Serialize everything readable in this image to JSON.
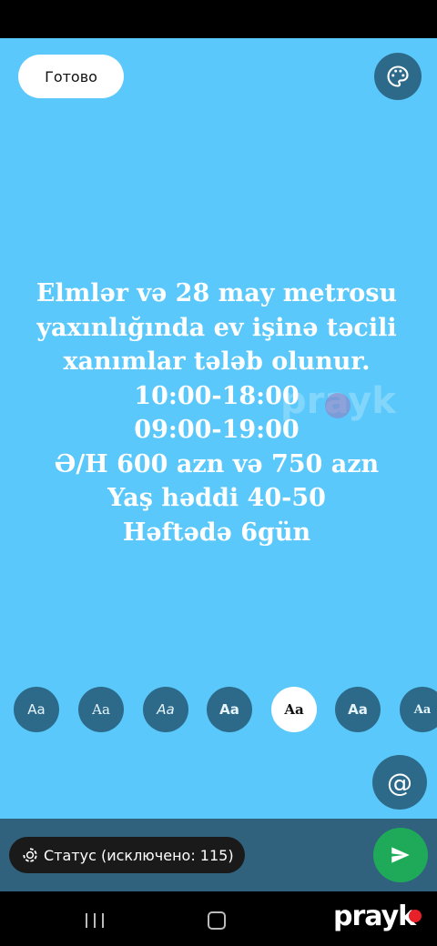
{
  "header": {
    "done_label": "Готово",
    "palette_icon": "palette-icon"
  },
  "story": {
    "background_color": "#5ac8fa",
    "lines": [
      "Elmlər və 28 may metrosu",
      "yaxınlığında ev işinə təcili",
      "xanımlar tələb olunur.",
      "10:00-18:00",
      "09:00-19:00",
      "Ə/H 600 azn və 750 azn",
      "Yaş həddi 40-50",
      "Həftədə 6gün"
    ]
  },
  "watermark": {
    "text": "prayk"
  },
  "font_options": {
    "items": [
      {
        "label": "Aa",
        "selected": false
      },
      {
        "label": "Aa",
        "selected": false
      },
      {
        "label": "Aa",
        "selected": false
      },
      {
        "label": "Aa",
        "selected": false
      },
      {
        "label": "Aa",
        "selected": true
      },
      {
        "label": "Aa",
        "selected": false
      },
      {
        "label": "Aa",
        "selected": false
      }
    ]
  },
  "mention": {
    "icon": "at-icon",
    "symbol": "@"
  },
  "footer": {
    "status_label": "Статус (исключено: 115)",
    "send_icon": "send-icon",
    "accent_color": "#1faa59"
  },
  "nav": {
    "logo_text": "prayk"
  }
}
